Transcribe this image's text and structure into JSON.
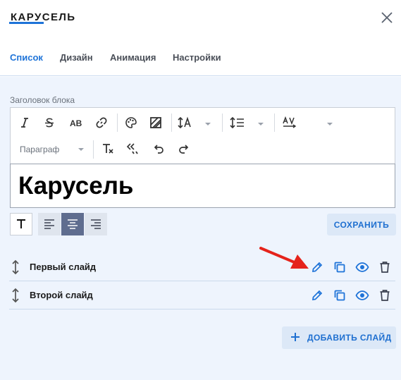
{
  "dialog": {
    "title": "КАРУСЕЛЬ",
    "close_icon": "close-icon"
  },
  "tabs": [
    {
      "label": "Список",
      "active": true
    },
    {
      "label": "Дизайн",
      "active": false
    },
    {
      "label": "Анимация",
      "active": false
    },
    {
      "label": "Настройки",
      "active": false
    }
  ],
  "block_title": {
    "label": "Заголовок блока",
    "value": "Карусель",
    "toolbar": {
      "italic_icon": "italic-icon",
      "strike_icon": "strikethrough-icon",
      "case_label": "AB",
      "link_icon": "link-icon",
      "palette_icon": "palette-icon",
      "fill_icon": "background-fill-icon",
      "font_size_icon": "font-size-icon",
      "line_height_icon": "line-height-icon",
      "letter_spacing_icon": "letter-spacing-icon",
      "paragraph_label": "Параграф",
      "clear_format_icon": "clear-format-icon",
      "quote_icon": "quote-icon",
      "undo_icon": "undo-icon",
      "redo_icon": "redo-icon"
    }
  },
  "alignment": {
    "options": [
      "text-style",
      "left",
      "center",
      "right"
    ],
    "selected": "center"
  },
  "save_label": "СОХРАНИТЬ",
  "slides": [
    {
      "name": "Первый слайд"
    },
    {
      "name": "Второй слайд"
    }
  ],
  "add_slide_label": "ДОБАВИТЬ СЛАЙД",
  "colors": {
    "accent": "#1e73d8",
    "panel_bg": "#eef4fd",
    "button_bg": "#dce8f7",
    "annotation_arrow": "#e5231b",
    "align_active": "#5f6d8f"
  }
}
